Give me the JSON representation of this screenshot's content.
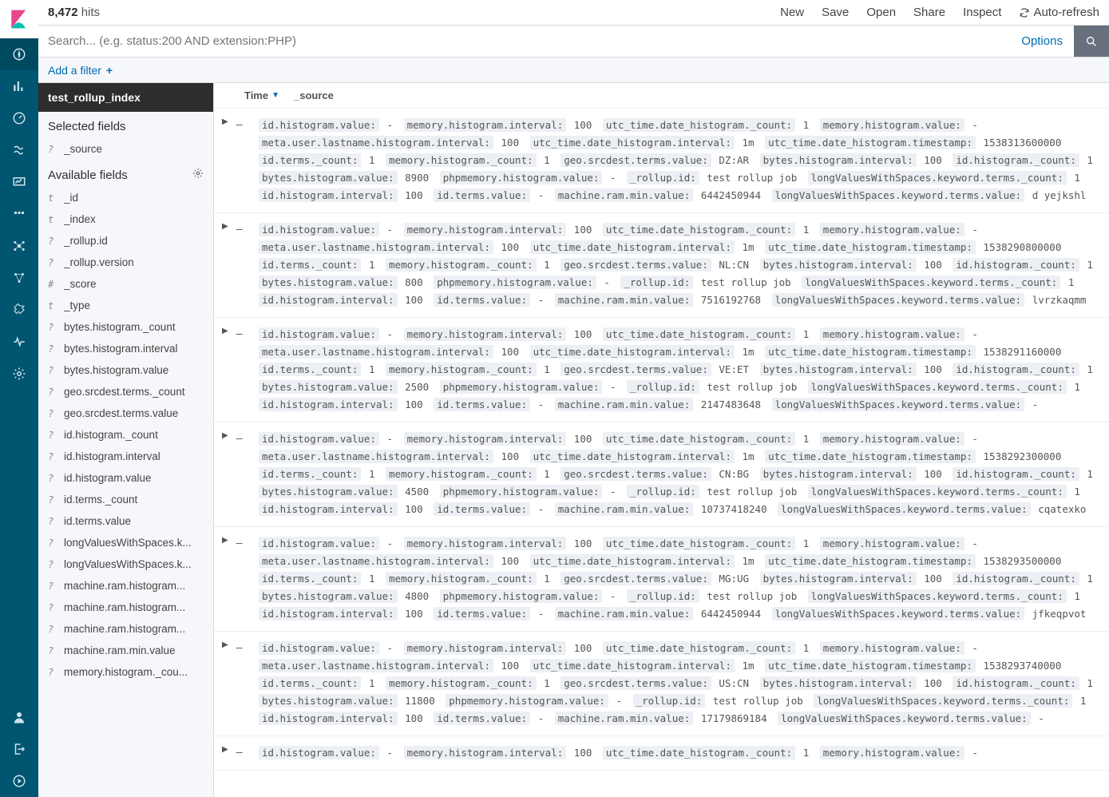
{
  "hits_count": "8,472",
  "hits_label": "hits",
  "top_actions": [
    "New",
    "Save",
    "Open",
    "Share",
    "Inspect"
  ],
  "auto_refresh": "Auto-refresh",
  "search_placeholder": "Search... (e.g. status:200 AND extension:PHP)",
  "options_label": "Options",
  "add_filter": "Add a filter",
  "index_title": "test_rollup_index",
  "selected_fields_h": "Selected fields",
  "available_fields_h": "Available fields",
  "selected_fields": [
    {
      "t": "?",
      "n": "_source"
    }
  ],
  "available_fields": [
    {
      "t": "t",
      "n": "_id"
    },
    {
      "t": "t",
      "n": "_index"
    },
    {
      "t": "?",
      "n": "_rollup.id"
    },
    {
      "t": "?",
      "n": "_rollup.version"
    },
    {
      "t": "#",
      "n": "_score"
    },
    {
      "t": "t",
      "n": "_type"
    },
    {
      "t": "?",
      "n": "bytes.histogram._count"
    },
    {
      "t": "?",
      "n": "bytes.histogram.interval"
    },
    {
      "t": "?",
      "n": "bytes.histogram.value"
    },
    {
      "t": "?",
      "n": "geo.srcdest.terms._count"
    },
    {
      "t": "?",
      "n": "geo.srcdest.terms.value"
    },
    {
      "t": "?",
      "n": "id.histogram._count"
    },
    {
      "t": "?",
      "n": "id.histogram.interval"
    },
    {
      "t": "?",
      "n": "id.histogram.value"
    },
    {
      "t": "?",
      "n": "id.terms._count"
    },
    {
      "t": "?",
      "n": "id.terms.value"
    },
    {
      "t": "?",
      "n": "longValuesWithSpaces.k..."
    },
    {
      "t": "?",
      "n": "longValuesWithSpaces.k..."
    },
    {
      "t": "?",
      "n": "machine.ram.histogram..."
    },
    {
      "t": "?",
      "n": "machine.ram.histogram..."
    },
    {
      "t": "?",
      "n": "machine.ram.histogram..."
    },
    {
      "t": "?",
      "n": "machine.ram.min.value"
    },
    {
      "t": "?",
      "n": "memory.histogram._cou..."
    }
  ],
  "col_time": "Time",
  "col_source": "_source",
  "docs": [
    {
      "kv": [
        [
          "id.histogram.value:",
          "-"
        ],
        [
          "memory.histogram.interval:",
          "100"
        ],
        [
          "utc_time.date_histogram._count:",
          "1"
        ],
        [
          "memory.histogram.value:",
          "-"
        ],
        [
          "meta.user.lastname.histogram.interval:",
          "100"
        ],
        [
          "utc_time.date_histogram.interval:",
          "1m"
        ],
        [
          "utc_time.date_histogram.timestamp:",
          "1538313600000"
        ],
        [
          "id.terms._count:",
          "1"
        ],
        [
          "memory.histogram._count:",
          "1"
        ],
        [
          "geo.srcdest.terms.value:",
          "DZ:AR"
        ],
        [
          "bytes.histogram.interval:",
          "100"
        ],
        [
          "id.histogram._count:",
          "1"
        ],
        [
          "bytes.histogram.value:",
          "8900"
        ],
        [
          "phpmemory.histogram.value:",
          "-"
        ],
        [
          "_rollup.id:",
          "test rollup job"
        ],
        [
          "longValuesWithSpaces.keyword.terms._count:",
          "1"
        ],
        [
          "id.histogram.interval:",
          "100"
        ],
        [
          "id.terms.value:",
          "-"
        ],
        [
          "machine.ram.min.value:",
          "6442450944"
        ],
        [
          "longValuesWithSpaces.keyword.terms.value:",
          "d yejkshl"
        ]
      ]
    },
    {
      "kv": [
        [
          "id.histogram.value:",
          "-"
        ],
        [
          "memory.histogram.interval:",
          "100"
        ],
        [
          "utc_time.date_histogram._count:",
          "1"
        ],
        [
          "memory.histogram.value:",
          "-"
        ],
        [
          "meta.user.lastname.histogram.interval:",
          "100"
        ],
        [
          "utc_time.date_histogram.interval:",
          "1m"
        ],
        [
          "utc_time.date_histogram.timestamp:",
          "1538290800000"
        ],
        [
          "id.terms._count:",
          "1"
        ],
        [
          "memory.histogram._count:",
          "1"
        ],
        [
          "geo.srcdest.terms.value:",
          "NL:CN"
        ],
        [
          "bytes.histogram.interval:",
          "100"
        ],
        [
          "id.histogram._count:",
          "1"
        ],
        [
          "bytes.histogram.value:",
          "800"
        ],
        [
          "phpmemory.histogram.value:",
          "-"
        ],
        [
          "_rollup.id:",
          "test rollup job"
        ],
        [
          "longValuesWithSpaces.keyword.terms._count:",
          "1"
        ],
        [
          "id.histogram.interval:",
          "100"
        ],
        [
          "id.terms.value:",
          "-"
        ],
        [
          "machine.ram.min.value:",
          "7516192768"
        ],
        [
          "longValuesWithSpaces.keyword.terms.value:",
          "lvrzkaqmm"
        ]
      ]
    },
    {
      "kv": [
        [
          "id.histogram.value:",
          "-"
        ],
        [
          "memory.histogram.interval:",
          "100"
        ],
        [
          "utc_time.date_histogram._count:",
          "1"
        ],
        [
          "memory.histogram.value:",
          "-"
        ],
        [
          "meta.user.lastname.histogram.interval:",
          "100"
        ],
        [
          "utc_time.date_histogram.interval:",
          "1m"
        ],
        [
          "utc_time.date_histogram.timestamp:",
          "1538291160000"
        ],
        [
          "id.terms._count:",
          "1"
        ],
        [
          "memory.histogram._count:",
          "1"
        ],
        [
          "geo.srcdest.terms.value:",
          "VE:ET"
        ],
        [
          "bytes.histogram.interval:",
          "100"
        ],
        [
          "id.histogram._count:",
          "1"
        ],
        [
          "bytes.histogram.value:",
          "2500"
        ],
        [
          "phpmemory.histogram.value:",
          "-"
        ],
        [
          "_rollup.id:",
          "test rollup job"
        ],
        [
          "longValuesWithSpaces.keyword.terms._count:",
          "1"
        ],
        [
          "id.histogram.interval:",
          "100"
        ],
        [
          "id.terms.value:",
          "-"
        ],
        [
          "machine.ram.min.value:",
          "2147483648"
        ],
        [
          "longValuesWithSpaces.keyword.terms.value:",
          "-"
        ]
      ]
    },
    {
      "kv": [
        [
          "id.histogram.value:",
          "-"
        ],
        [
          "memory.histogram.interval:",
          "100"
        ],
        [
          "utc_time.date_histogram._count:",
          "1"
        ],
        [
          "memory.histogram.value:",
          "-"
        ],
        [
          "meta.user.lastname.histogram.interval:",
          "100"
        ],
        [
          "utc_time.date_histogram.interval:",
          "1m"
        ],
        [
          "utc_time.date_histogram.timestamp:",
          "1538292300000"
        ],
        [
          "id.terms._count:",
          "1"
        ],
        [
          "memory.histogram._count:",
          "1"
        ],
        [
          "geo.srcdest.terms.value:",
          "CN:BG"
        ],
        [
          "bytes.histogram.interval:",
          "100"
        ],
        [
          "id.histogram._count:",
          "1"
        ],
        [
          "bytes.histogram.value:",
          "4500"
        ],
        [
          "phpmemory.histogram.value:",
          "-"
        ],
        [
          "_rollup.id:",
          "test rollup job"
        ],
        [
          "longValuesWithSpaces.keyword.terms._count:",
          "1"
        ],
        [
          "id.histogram.interval:",
          "100"
        ],
        [
          "id.terms.value:",
          "-"
        ],
        [
          "machine.ram.min.value:",
          "10737418240"
        ],
        [
          "longValuesWithSpaces.keyword.terms.value:",
          "cqatexko"
        ]
      ]
    },
    {
      "kv": [
        [
          "id.histogram.value:",
          "-"
        ],
        [
          "memory.histogram.interval:",
          "100"
        ],
        [
          "utc_time.date_histogram._count:",
          "1"
        ],
        [
          "memory.histogram.value:",
          "-"
        ],
        [
          "meta.user.lastname.histogram.interval:",
          "100"
        ],
        [
          "utc_time.date_histogram.interval:",
          "1m"
        ],
        [
          "utc_time.date_histogram.timestamp:",
          "1538293500000"
        ],
        [
          "id.terms._count:",
          "1"
        ],
        [
          "memory.histogram._count:",
          "1"
        ],
        [
          "geo.srcdest.terms.value:",
          "MG:UG"
        ],
        [
          "bytes.histogram.interval:",
          "100"
        ],
        [
          "id.histogram._count:",
          "1"
        ],
        [
          "bytes.histogram.value:",
          "4800"
        ],
        [
          "phpmemory.histogram.value:",
          "-"
        ],
        [
          "_rollup.id:",
          "test rollup job"
        ],
        [
          "longValuesWithSpaces.keyword.terms._count:",
          "1"
        ],
        [
          "id.histogram.interval:",
          "100"
        ],
        [
          "id.terms.value:",
          "-"
        ],
        [
          "machine.ram.min.value:",
          "6442450944"
        ],
        [
          "longValuesWithSpaces.keyword.terms.value:",
          "jfkeqpvot"
        ]
      ]
    },
    {
      "kv": [
        [
          "id.histogram.value:",
          "-"
        ],
        [
          "memory.histogram.interval:",
          "100"
        ],
        [
          "utc_time.date_histogram._count:",
          "1"
        ],
        [
          "memory.histogram.value:",
          "-"
        ],
        [
          "meta.user.lastname.histogram.interval:",
          "100"
        ],
        [
          "utc_time.date_histogram.interval:",
          "1m"
        ],
        [
          "utc_time.date_histogram.timestamp:",
          "1538293740000"
        ],
        [
          "id.terms._count:",
          "1"
        ],
        [
          "memory.histogram._count:",
          "1"
        ],
        [
          "geo.srcdest.terms.value:",
          "US:CN"
        ],
        [
          "bytes.histogram.interval:",
          "100"
        ],
        [
          "id.histogram._count:",
          "1"
        ],
        [
          "bytes.histogram.value:",
          "11800"
        ],
        [
          "phpmemory.histogram.value:",
          "-"
        ],
        [
          "_rollup.id:",
          "test rollup job"
        ],
        [
          "longValuesWithSpaces.keyword.terms._count:",
          "1"
        ],
        [
          "id.histogram.interval:",
          "100"
        ],
        [
          "id.terms.value:",
          "-"
        ],
        [
          "machine.ram.min.value:",
          "17179869184"
        ],
        [
          "longValuesWithSpaces.keyword.terms.value:",
          "-"
        ]
      ]
    },
    {
      "kv": [
        [
          "id.histogram.value:",
          "-"
        ],
        [
          "memory.histogram.interval:",
          "100"
        ],
        [
          "utc_time.date_histogram._count:",
          "1"
        ],
        [
          "memory.histogram.value:",
          "-"
        ]
      ]
    }
  ]
}
